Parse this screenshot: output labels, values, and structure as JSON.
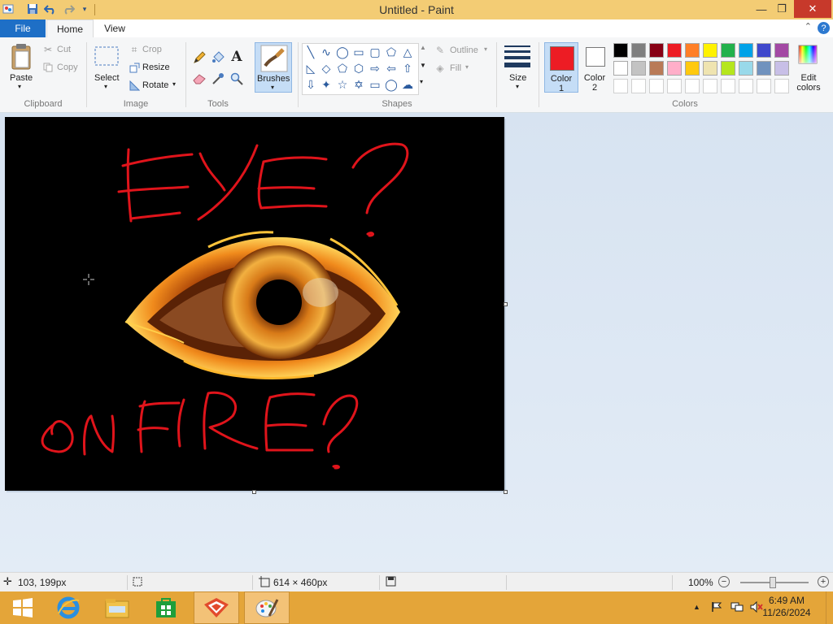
{
  "window": {
    "title": "Untitled - Paint",
    "minimize": "—",
    "restore": "❐",
    "close": "✕"
  },
  "quick_access": [
    "paint-icon",
    "save-icon",
    "undo-icon",
    "redo-icon",
    "customize-icon"
  ],
  "tabs": {
    "file": "File",
    "home": "Home",
    "view": "View",
    "help": "?"
  },
  "clipboard": {
    "paste": "Paste",
    "cut": "Cut",
    "copy": "Copy",
    "group": "Clipboard"
  },
  "image": {
    "select": "Select",
    "crop": "Crop",
    "resize": "Resize",
    "rotate": "Rotate",
    "group": "Image"
  },
  "tools": {
    "group": "Tools",
    "text_icon": "A"
  },
  "brushes": {
    "label": "Brushes"
  },
  "shapes": {
    "outline": "Outline",
    "fill": "Fill",
    "group": "Shapes"
  },
  "size": {
    "label": "Size"
  },
  "colors": {
    "color1_label": "Color",
    "color1_num": "1",
    "color2_label": "Color",
    "color2_num": "2",
    "edit1": "Edit",
    "edit2": "colors",
    "group": "Colors",
    "color1": "#ed1c24",
    "color2": "#ffffff",
    "palette_row1": [
      "#000000",
      "#7f7f7f",
      "#880015",
      "#ed1c24",
      "#ff7f27",
      "#fff200",
      "#22b14c",
      "#00a2e8",
      "#3f48cc",
      "#a349a4"
    ],
    "palette_row2": [
      "#ffffff",
      "#c3c3c3",
      "#b97a57",
      "#ffaec9",
      "#ffc90e",
      "#efe4b0",
      "#b5e61d",
      "#99d9ea",
      "#7092be",
      "#c8bfe7"
    ]
  },
  "canvas": {
    "text_top": "EYE?",
    "text_bottom": "ONFIRE?",
    "ink_color": "#e0141b"
  },
  "status": {
    "cursor_pos": "103, 199px",
    "canvas_size": "614 × 460px",
    "zoom": "100%",
    "zoom_out": "−",
    "zoom_in": "+"
  },
  "taskbar": {
    "time": "6:49 AM",
    "date": "11/26/2024",
    "tray_expand": "▲"
  }
}
